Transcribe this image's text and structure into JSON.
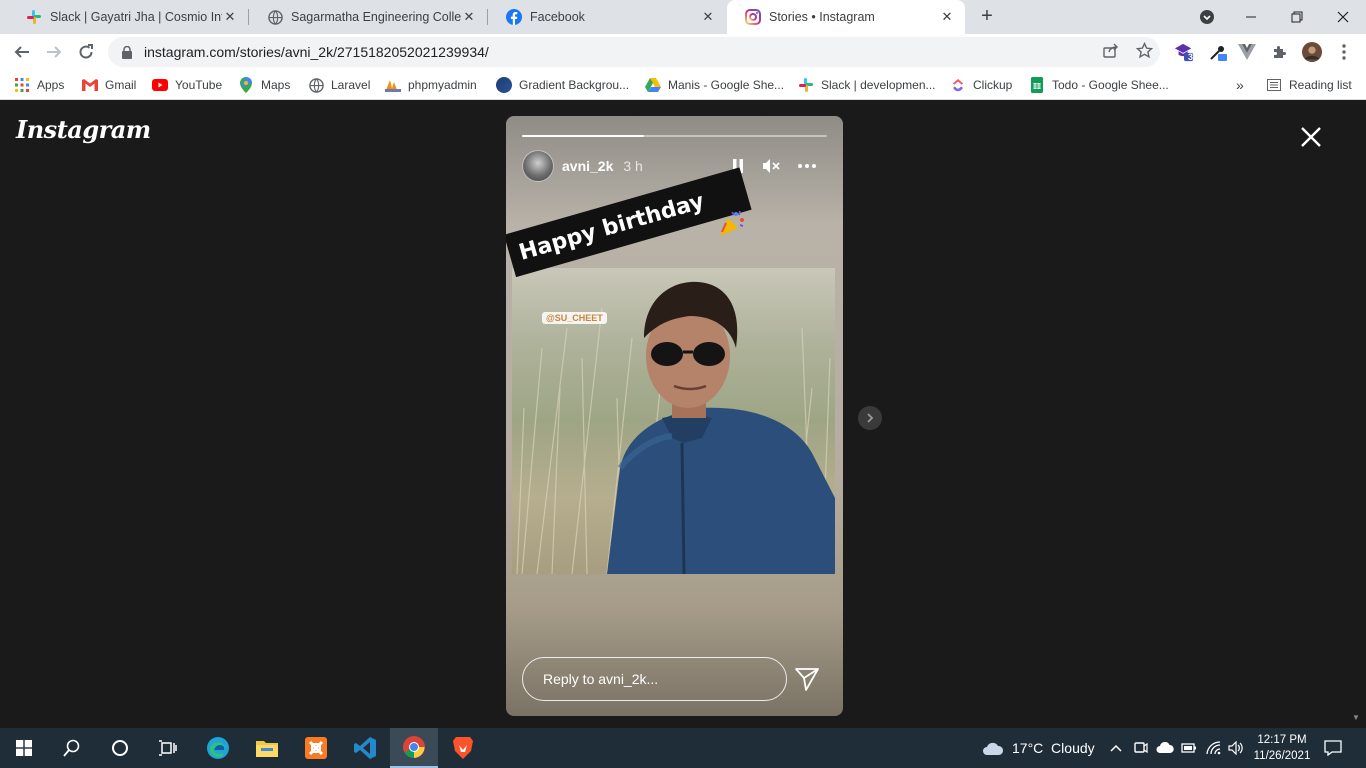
{
  "tabs": [
    {
      "title": "Slack | Gayatri Jha | Cosmio Info Tech",
      "icon": "slack-icon"
    },
    {
      "title": "Sagarmatha Engineering College",
      "icon": "globe-icon"
    },
    {
      "title": "Facebook",
      "icon": "facebook-icon"
    },
    {
      "title": "Stories • Instagram",
      "icon": "instagram-icon",
      "active": true
    }
  ],
  "toolbar": {
    "url": "instagram.com/stories/avni_2k/2715182052021239934/"
  },
  "extensions": {
    "badge_count": "3"
  },
  "bookmarks": [
    {
      "label": "Apps",
      "icon": "apps-grid-icon"
    },
    {
      "label": "Gmail",
      "icon": "gmail-icon"
    },
    {
      "label": "YouTube",
      "icon": "youtube-icon"
    },
    {
      "label": "Maps",
      "icon": "maps-icon"
    },
    {
      "label": "Laravel",
      "icon": "globe-icon"
    },
    {
      "label": "phpmyadmin",
      "icon": "phpmyadmin-icon"
    },
    {
      "label": "Gradient Backgrou...",
      "icon": "gradient-icon"
    },
    {
      "label": "Manis - Google She...",
      "icon": "google-drive-icon"
    },
    {
      "label": "Slack | developmen...",
      "icon": "slack-icon"
    },
    {
      "label": "Clickup",
      "icon": "clickup-icon"
    },
    {
      "label": "Todo - Google Shee...",
      "icon": "google-sheets-icon"
    }
  ],
  "bookmarks_overflow": "»",
  "reading_list": "Reading list",
  "instagram": {
    "logo": "Instagram",
    "story": {
      "username": "avni_2k",
      "time": "3 h",
      "progress": 0.4,
      "sticker_text": "Happy birthday",
      "mention": "@SU_CHEET",
      "reply_placeholder": "Reply to avni_2k..."
    }
  },
  "taskbar": {
    "weather": "17°C  Cloudy",
    "time": "12:17 PM",
    "date": "11/26/2021"
  }
}
